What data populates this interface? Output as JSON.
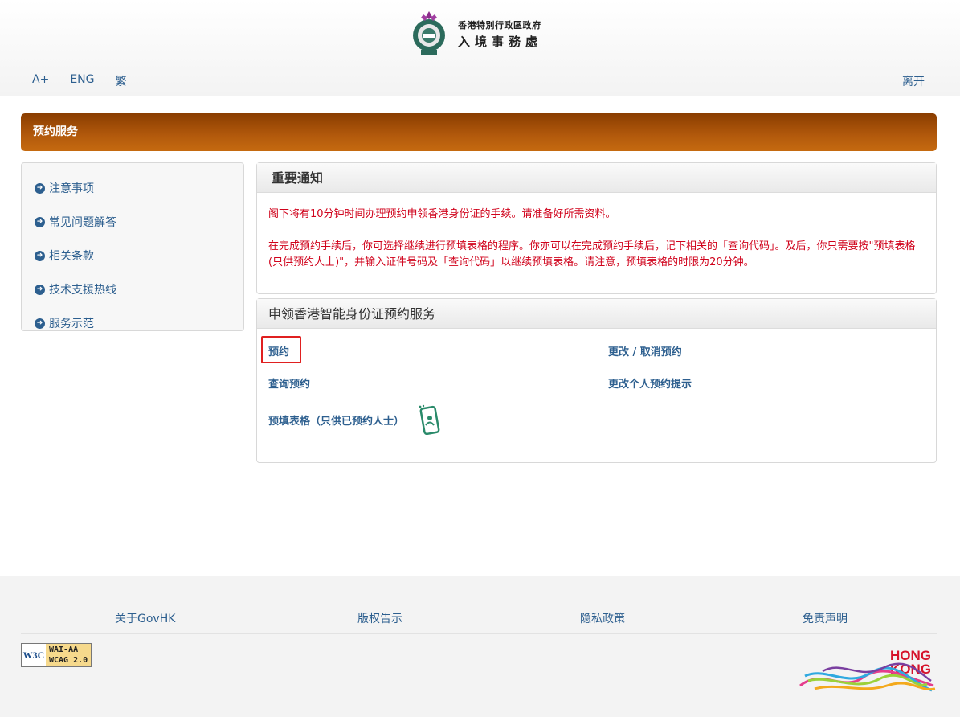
{
  "header": {
    "logo_line1": "香港特別行政區政府",
    "logo_line2": "入境事務處",
    "font_increase": "A+",
    "lang_eng": "ENG",
    "lang_trad": "繁",
    "exit": "离开"
  },
  "banner": {
    "title": "预约服务"
  },
  "sidebar": {
    "items": [
      {
        "label": "注意事项"
      },
      {
        "label": "常见问题解答"
      },
      {
        "label": "相关条款"
      },
      {
        "label": "技术支援热线"
      },
      {
        "label": "服务示范"
      }
    ]
  },
  "notice": {
    "title": "重要通知",
    "para1": "阁下将有10分钟时间办理预约申领香港身份证的手续。请准备好所需资料。",
    "para2": "在完成预约手续后，你可选择继续进行预填表格的程序。你亦可以在完成预约手续后，记下相关的「查询代码」。及后，你只需要按\"预填表格(只供预约人士)\"，并输入证件号码及「查询代码」以继续预填表格。请注意，预填表格的时限为20分钟。"
  },
  "service": {
    "title": "申领香港智能身份证预约服务",
    "links": {
      "book": "预约",
      "change_cancel": "更改 / 取消预约",
      "enquire": "查询预约",
      "change_reminder": "更改个人预约提示",
      "prefill": "预填表格（只供已预约人士）"
    }
  },
  "footer": {
    "links": [
      "关于GovHK",
      "版权告示",
      "隐私政策",
      "免责声明"
    ],
    "w3c": "W3C",
    "wai_line1": "WAI-AA",
    "wai_line2": "WCAG 2.0",
    "hk_brand_line1": "HONG",
    "hk_brand_line2": "KONG"
  },
  "colors": {
    "link": "#2d5f8f",
    "notice_text": "#d0021b",
    "banner": "#b35a0c",
    "highlight": "#e02020"
  }
}
